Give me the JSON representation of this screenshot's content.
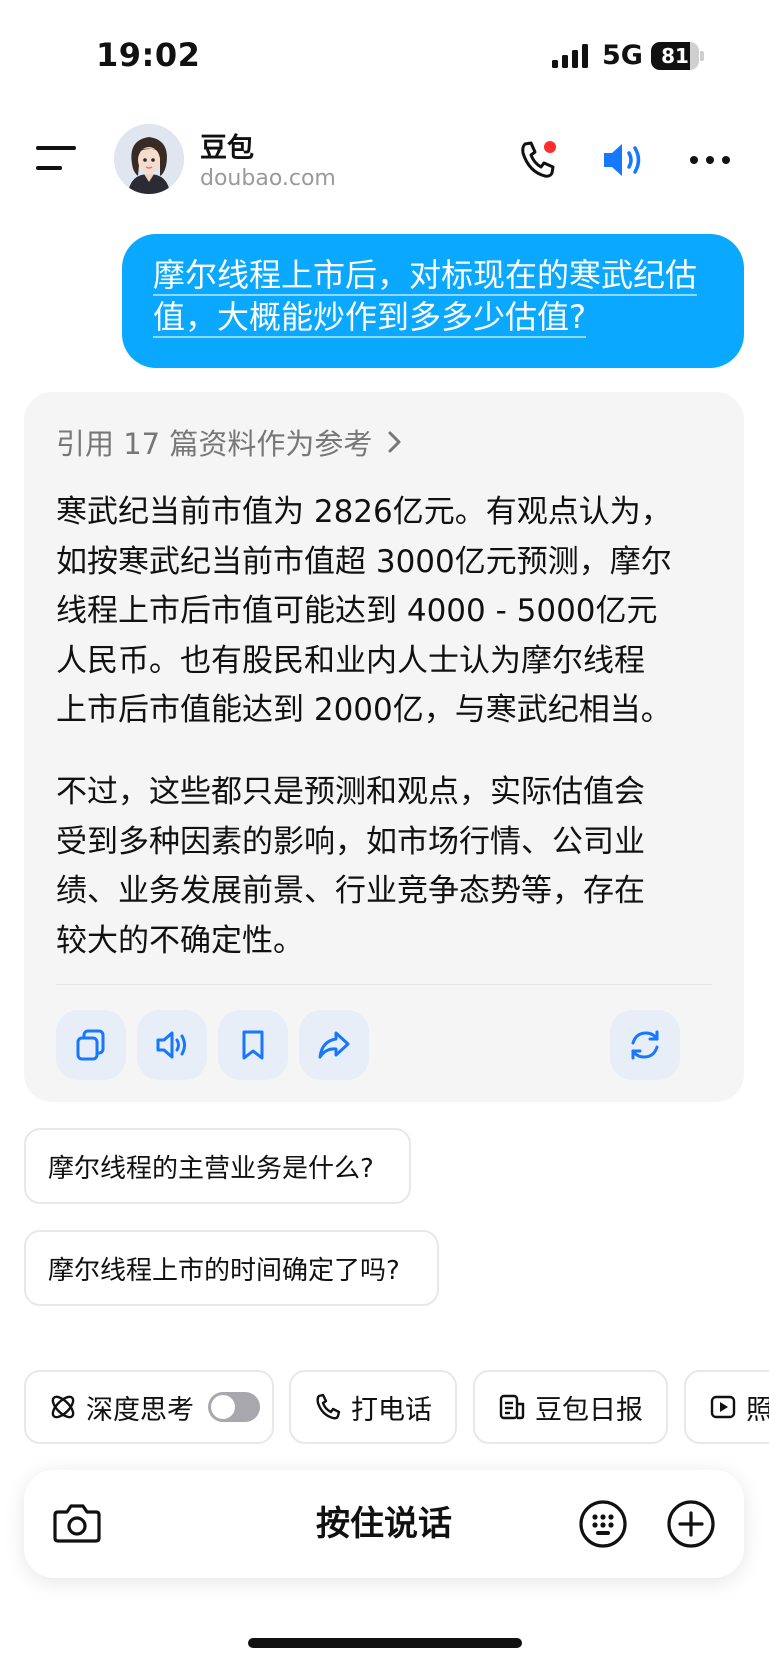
{
  "status_bar": {
    "time": "19:02",
    "network": "5G",
    "battery": "81",
    "battery_level": 0.81
  },
  "header": {
    "bot_name": "豆包",
    "bot_domain": "doubao.com",
    "icons": [
      "menu-icon",
      "phone-icon",
      "speaker-icon",
      "more-icon"
    ],
    "call_badge_color": "#ff2d2d",
    "speaker_color": "#1677ff"
  },
  "user_message": {
    "line1": "摩尔线程上市后，对标现在的寒武纪估",
    "line2": "值，大概能炒作到多多少估值?",
    "bubble_color": "#0aa8ff"
  },
  "answer": {
    "reference": "引用 17 篇资料作为参考",
    "para1": [
      "寒武纪当前市值为 2826亿元。有观点认为，",
      "如按寒武纪当前市值超 3000亿元预测，摩尔",
      "线程上市后市值可能达到 4000 - 5000亿元",
      "人民币。也有股民和业内人士认为摩尔线程",
      "上市后市值能达到 2000亿，与寒武纪相当。"
    ],
    "para2": [
      "不过，这些都只是预测和观点，实际估值会",
      "受到多种因素的影响，如市场行情、公司业",
      "绩、业务发展前景、行业竞争态势等，存在",
      "较大的不确定性。"
    ],
    "actions": [
      "copy-icon",
      "read-aloud-icon",
      "bookmark-icon",
      "share-icon",
      "regenerate-icon"
    ]
  },
  "suggestions": [
    "摩尔线程的主营业务是什么?",
    "摩尔线程上市的时间确定了吗?"
  ],
  "tools": {
    "deep_think": "深度思考",
    "deep_think_on": false,
    "call": "打电话",
    "daily": "豆包日报",
    "photo": "照"
  },
  "input_bar": {
    "hold_to_speak": "按住说话"
  }
}
